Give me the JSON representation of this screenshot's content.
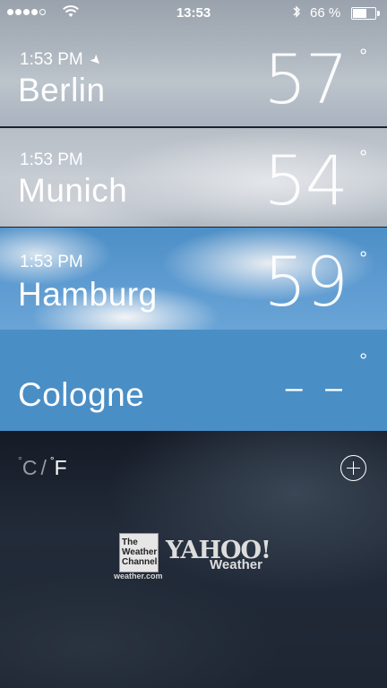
{
  "status_bar": {
    "clock": "13:53",
    "battery_percent": "66 %",
    "battery_level": 0.66,
    "signal_bars": 4,
    "signal_total": 5
  },
  "cities": [
    {
      "time": "1:53 PM",
      "name": "Berlin",
      "temp": "57",
      "degree": "°",
      "current_location": true
    },
    {
      "time": "1:53 PM",
      "name": "Munich",
      "temp": "54",
      "degree": "°",
      "current_location": false
    },
    {
      "time": "1:53 PM",
      "name": "Hamburg",
      "temp": "59",
      "degree": "°",
      "current_location": false
    },
    {
      "time": "",
      "name": "Cologne",
      "temp": "– –",
      "degree": "°",
      "current_location": false
    }
  ],
  "units": {
    "celsius": "C",
    "separator": "/",
    "fahrenheit": "F",
    "degree": "°"
  },
  "branding": {
    "twc_line1": "The",
    "twc_line2": "Weather",
    "twc_line3": "Channel",
    "twc_url": "weather.com",
    "yahoo": "YAHOO!",
    "yahoo_sub": "Weather"
  },
  "icons": {
    "location": "location-arrow-icon",
    "add": "plus-circle-icon",
    "wifi": "wifi-icon",
    "bluetooth": "bluetooth-icon",
    "battery": "battery-icon"
  }
}
